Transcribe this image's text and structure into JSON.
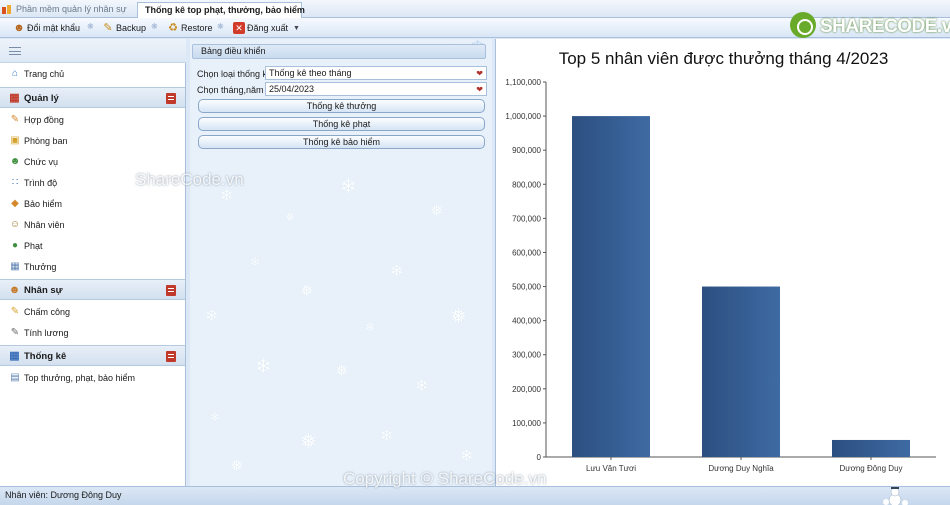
{
  "tabs": [
    {
      "label": "Phần mềm quản lý nhân sự"
    },
    {
      "label": "Thống kê top phạt, thưởng, bảo hiểm"
    }
  ],
  "toolbar": {
    "items": [
      {
        "label": "Đổi mật khẩu",
        "icon": "user-key-icon"
      },
      {
        "label": "Backup",
        "icon": "backup-icon"
      },
      {
        "label": "Restore",
        "icon": "restore-icon"
      },
      {
        "label": "Đăng xuất",
        "icon": "logout-icon"
      }
    ]
  },
  "logo": {
    "text": "SHARECODE.vn"
  },
  "sidebar": {
    "home": {
      "label": "Trang chủ",
      "icon": "home-icon"
    },
    "groups": [
      {
        "label": "Quản lý",
        "icon": "manage-icon",
        "items": [
          {
            "label": "Hợp đồng",
            "icon": "contract-icon"
          },
          {
            "label": "Phòng ban",
            "icon": "department-icon"
          },
          {
            "label": "Chức vụ",
            "icon": "position-icon"
          },
          {
            "label": "Trình độ",
            "icon": "education-icon"
          },
          {
            "label": "Bảo hiểm",
            "icon": "insurance-icon"
          },
          {
            "label": "Nhân viên",
            "icon": "employees-icon"
          },
          {
            "label": "Phạt",
            "icon": "penalty-icon"
          },
          {
            "label": "Thưởng",
            "icon": "reward-icon"
          }
        ]
      },
      {
        "label": "Nhân sự",
        "icon": "hr-icon",
        "items": [
          {
            "label": "Chấm công",
            "icon": "timesheet-icon"
          },
          {
            "label": "Tính lương",
            "icon": "salary-icon"
          }
        ]
      },
      {
        "label": "Thống kê",
        "icon": "statistics-icon",
        "items": [
          {
            "label": "Top thưởng, phạt, bảo hiểm",
            "icon": "report-icon"
          }
        ]
      }
    ]
  },
  "panel": {
    "header": "Bảng điều khiển",
    "type_label": "Chọn loại thống kê",
    "type_value": "Thống kê theo tháng",
    "month_label": "Chọn tháng,năm",
    "month_value": "25/04/2023",
    "buttons": [
      "Thống kê thưởng",
      "Thống kê phạt",
      "Thống kê bảo hiểm"
    ]
  },
  "chart_data": {
    "type": "bar",
    "title": "Top 5 nhân viên được thưởng tháng 4/2023",
    "categories": [
      "Lưu Văn Tươi",
      "Dương Duy Nghĩa",
      "Dương Đông Duy"
    ],
    "values": [
      1000000,
      500000,
      50000
    ],
    "ylim": [
      0,
      1100000
    ],
    "yticks": [
      "0",
      "100,000",
      "200,000",
      "300,000",
      "400,000",
      "500,000",
      "600,000",
      "700,000",
      "800,000",
      "900,000",
      "1,000,000",
      "1,100,000"
    ],
    "grid": false,
    "bar_color": "#3e6aa3"
  },
  "status": {
    "text": "Nhân viên: Dương Đông Duy"
  },
  "watermarks": [
    "ShareCode.vn",
    "Copyright © ShareCode.vn"
  ]
}
